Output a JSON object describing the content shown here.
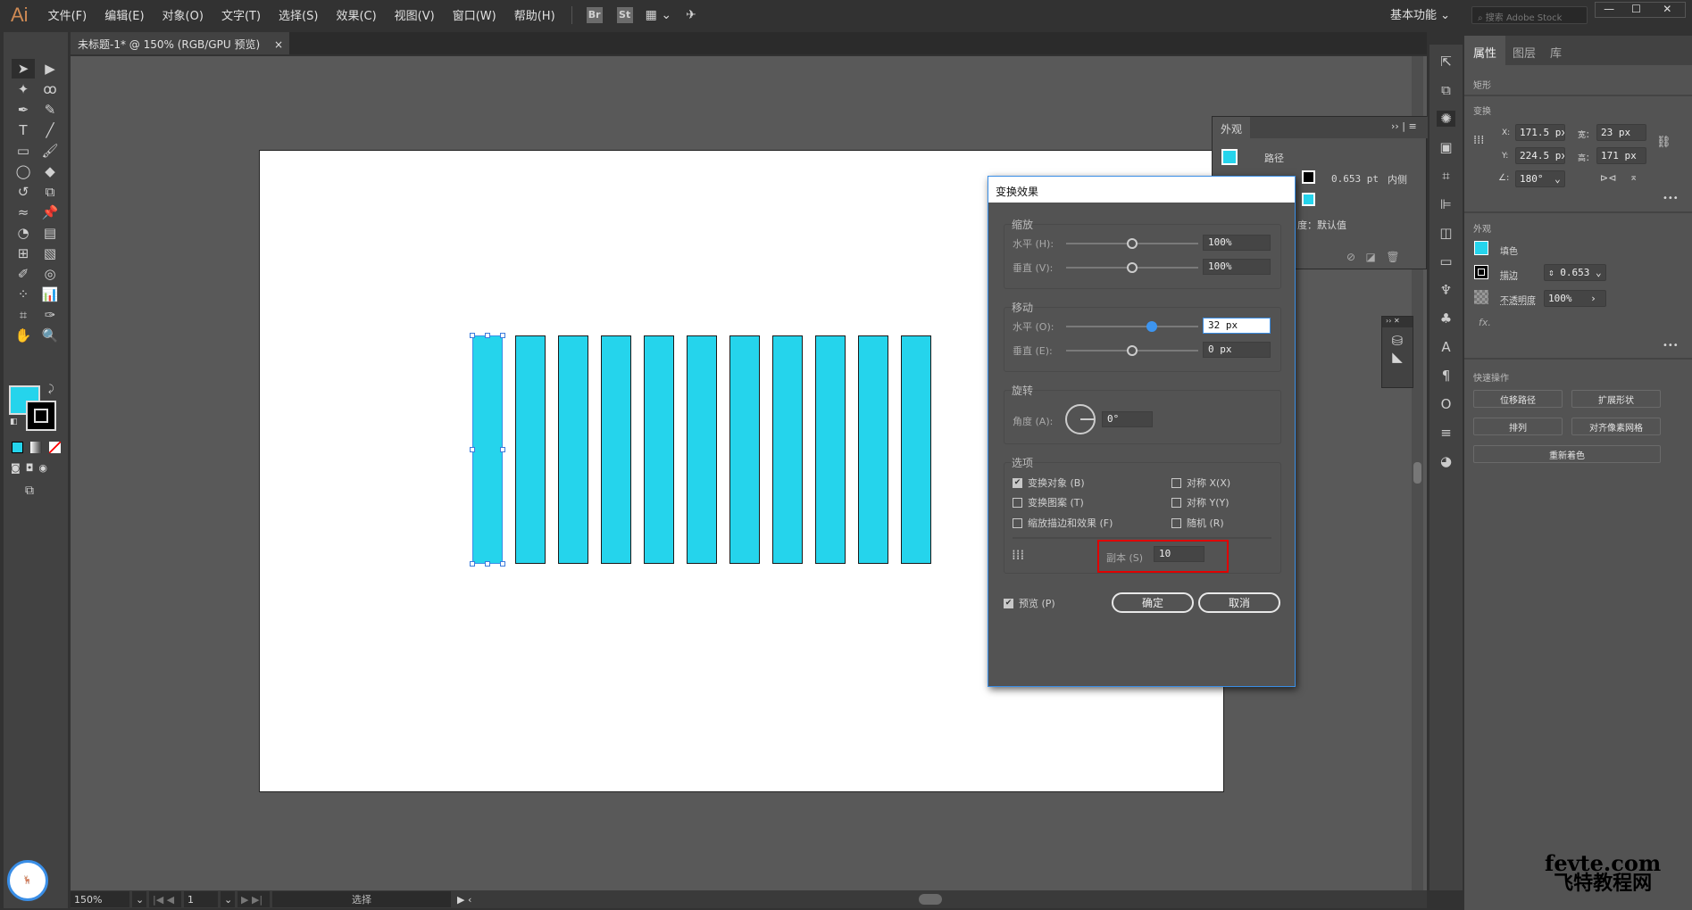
{
  "app": {
    "logo": "Ai",
    "menu": [
      "文件(F)",
      "编辑(E)",
      "对象(O)",
      "文字(T)",
      "选择(S)",
      "效果(C)",
      "视图(V)",
      "窗口(W)",
      "帮助(H)"
    ],
    "bridge": "Br",
    "stock": "St",
    "workspace": "基本功能",
    "search_placeholder": "搜索 Adobe Stock"
  },
  "document": {
    "tab_title": "未标题-1* @ 150% (RGB/GPU 预览)",
    "close": "×"
  },
  "colors": {
    "fill": "#25d4ec",
    "stroke": "#000000",
    "accent": "#3a8ee6"
  },
  "artwork": {
    "rect_count": 11
  },
  "status": {
    "zoom": "150%",
    "artboard": "1",
    "tool": "选择"
  },
  "dialog": {
    "title": "变换效果",
    "scale": {
      "label": "缩放",
      "h_label": "水平 (H):",
      "h_value": "100%",
      "v_label": "垂直 (V):",
      "v_value": "100%"
    },
    "move": {
      "label": "移动",
      "h_label": "水平 (O):",
      "h_value": "32 px",
      "v_label": "垂直 (E):",
      "v_value": "0 px"
    },
    "rotate": {
      "label": "旋转",
      "angle_label": "角度 (A):",
      "angle_value": "0°"
    },
    "options": {
      "label": "选项",
      "items": [
        {
          "label": "变换对象 (B)",
          "checked": true
        },
        {
          "label": "变换图案 (T)",
          "checked": false
        },
        {
          "label": "缩放描边和效果 (F)",
          "checked": false
        },
        {
          "label": "对称 X(X)",
          "checked": false
        },
        {
          "label": "对称 Y(Y)",
          "checked": false
        },
        {
          "label": "随机 (R)",
          "checked": false
        }
      ]
    },
    "copies_label": "副本 (S)",
    "copies_value": "10",
    "preview_label": "预览 (P)",
    "preview_checked": true,
    "ok": "确定",
    "cancel": "取消"
  },
  "appearance": {
    "title": "外观",
    "path_label": "路径",
    "stroke_value": "0.653 pt",
    "stroke_align": "内侧",
    "opacity_text": "度：默认值"
  },
  "properties": {
    "tabs": [
      "属性",
      "图层",
      "库"
    ],
    "object_type": "矩形",
    "transform_label": "变换",
    "x_label": "X:",
    "x": "171.5 px",
    "y_label": "Y:",
    "y": "224.5 px",
    "w_label": "宽：",
    "w": "23 px",
    "h_label": "高：",
    "h": "171 px",
    "angle": "180°",
    "appearance_label": "外观",
    "fill_label": "填色",
    "stroke_label": "描边",
    "stroke_value": "0.653",
    "opacity_label": "不透明度",
    "opacity_value": "100%",
    "fx": "fx.",
    "quick_label": "快速操作",
    "buttons": [
      "位移路径",
      "扩展形状",
      "排列",
      "对齐像素网格",
      "重新着色"
    ]
  },
  "watermark": {
    "line1": "fevte.com",
    "line2": "飞特教程网"
  }
}
